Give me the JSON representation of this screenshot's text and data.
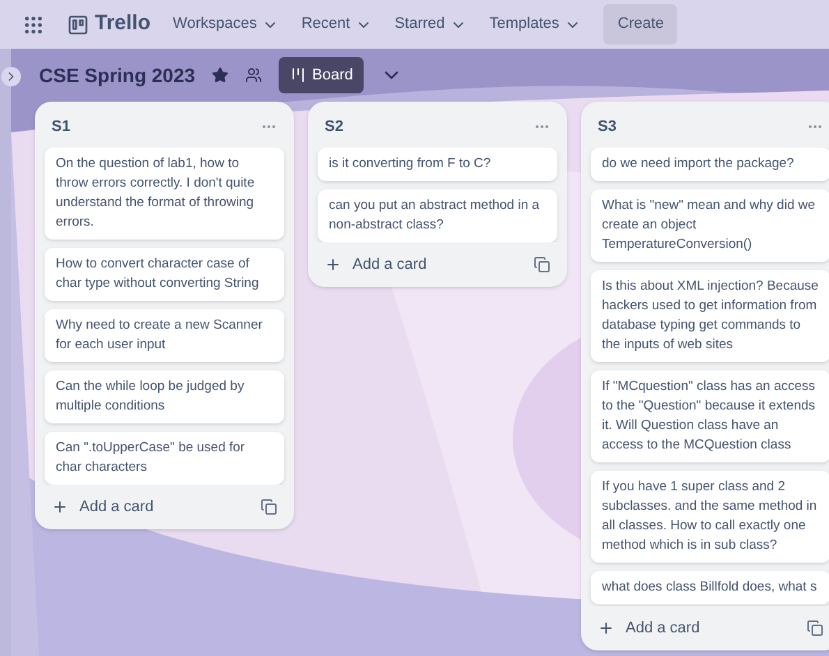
{
  "nav": {
    "brand": "Trello",
    "menus": [
      {
        "label": "Workspaces"
      },
      {
        "label": "Recent"
      },
      {
        "label": "Starred"
      },
      {
        "label": "Templates"
      }
    ],
    "create": "Create"
  },
  "board": {
    "title": "CSE Spring 2023",
    "view": "Board"
  },
  "lists": [
    {
      "title": "S1",
      "add": "Add a card",
      "cards": [
        "On the question of lab1, how to throw errors correctly. I don't quite understand the format of throwing errors.",
        "How to convert character case of char type without converting String",
        "Why need to create a new Scanner for each user input",
        "Can the while loop be judged by multiple conditions",
        "Can \".toUpperCase\" be used for char characters"
      ]
    },
    {
      "title": "S2",
      "add": "Add a card",
      "cards": [
        "is it converting from F to C?",
        "can you put an abstract method in a non-abstract class?"
      ]
    },
    {
      "title": "S3",
      "add": "Add a card",
      "cards": [
        "do we need import the package?",
        "What is \"new\" mean and why did we create an object TemperatureConversion()",
        "Is this about XML injection? Because hackers used to get information from database typing get commands to the inputs of web sites",
        "If \"MCquestion\" class has an access to the \"Question\" because it extends it. Will Question class have an access to the MCQuestion class",
        "If you have 1 super class and 2 subclasses. and the same method in all classes. How to call exactly one method which is in sub class?",
        "what does class Billfold does, what s"
      ]
    }
  ]
}
